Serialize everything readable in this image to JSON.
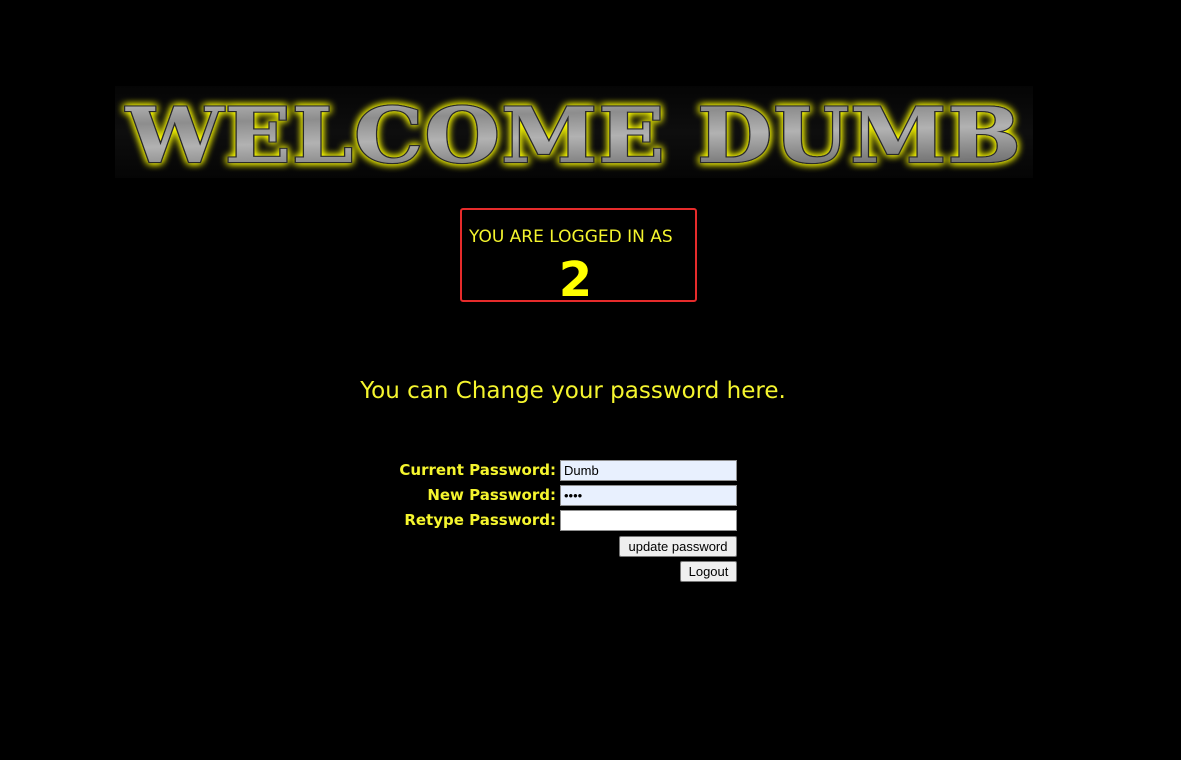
{
  "banner": {
    "title": "WELCOME DUMB"
  },
  "session": {
    "logged_in_label": "YOU ARE LOGGED IN AS",
    "user_id": "2"
  },
  "intro": {
    "text": "You can Change your password here."
  },
  "form": {
    "current_password_label": "Current Password:",
    "current_password_value": "Dumb",
    "new_password_label": "New Password:",
    "new_password_value": "••••",
    "retype_password_label": "Retype Password:",
    "retype_password_value": "",
    "update_button_label": "update password",
    "logout_button_label": "Logout"
  },
  "colors": {
    "background": "#000000",
    "text_accent": "#f5f52e",
    "user_id": "#ffff00",
    "box_border": "#e62b2b",
    "banner_glow": "#ffff00",
    "autofill_bg": "#e8f0fe"
  }
}
